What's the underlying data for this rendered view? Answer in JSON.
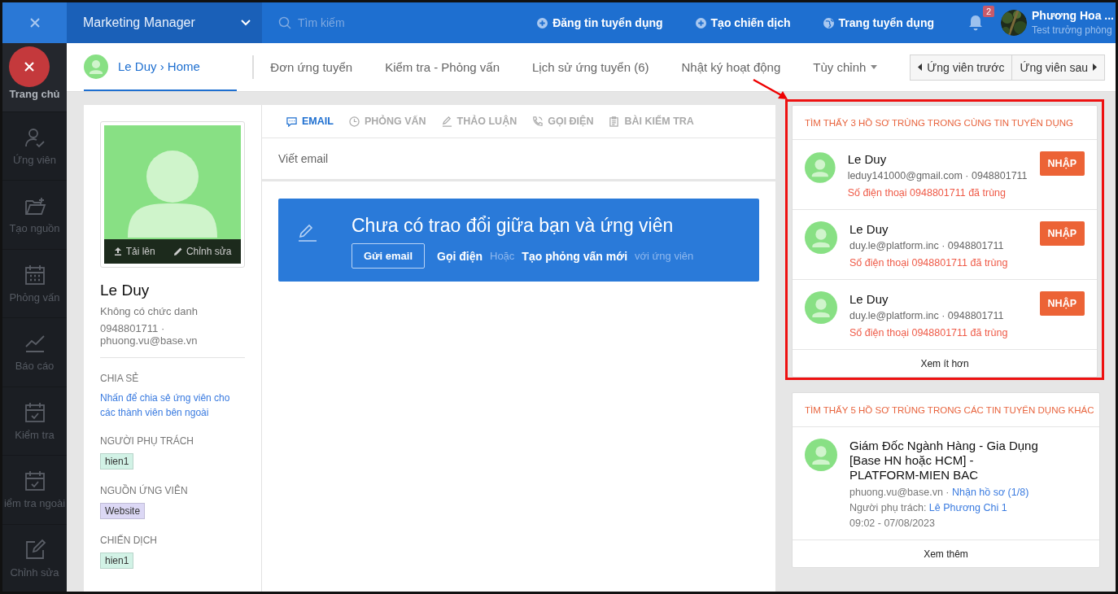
{
  "topbar": {
    "workspace": "Marketing Manager",
    "search": {
      "placeholder": "Tìm kiếm"
    },
    "actions": [
      {
        "label": "Đăng tin tuyển dụng"
      },
      {
        "label": "Tạo chiến dịch"
      },
      {
        "label": "Trang tuyển dụng"
      }
    ],
    "notifications": {
      "count": "2"
    },
    "user": {
      "name": "Phương Hoa ...",
      "role": "Test trưởng phòng"
    }
  },
  "sidebar": {
    "items": [
      {
        "label": "Trang chủ",
        "selected": true
      },
      {
        "label": "Ứng viên",
        "selected": false
      },
      {
        "label": "Tạo nguồn",
        "selected": false
      },
      {
        "label": "Phỏng vấn",
        "selected": false
      },
      {
        "label": "Báo cáo",
        "selected": false
      },
      {
        "label": "Kiểm tra",
        "selected": false
      },
      {
        "label": "iểm tra ngoài",
        "selected": false
      },
      {
        "label": "Chỉnh sửa",
        "selected": false
      }
    ]
  },
  "breadcrumb": {
    "name": "Le Duy",
    "separator": "›",
    "page": "Home",
    "selected": true
  },
  "tabs": [
    {
      "label": "Đơn ứng tuyển",
      "selected": false,
      "dropdown": false
    },
    {
      "label": "Kiểm tra - Phỏng vấn",
      "selected": false,
      "dropdown": false
    },
    {
      "label": "Lịch sử ứng tuyển (6)",
      "selected": false,
      "dropdown": false
    },
    {
      "label": "Nhật ký hoạt động",
      "selected": false,
      "dropdown": false
    },
    {
      "label": "Tùy chỉnh",
      "selected": false,
      "dropdown": true
    }
  ],
  "nav_buttons": [
    {
      "label": "Ứng viên trước"
    },
    {
      "label": "Ứng viên sau"
    }
  ],
  "profile": {
    "photo_actions": [
      {
        "label": "Tải lên"
      },
      {
        "label": "Chỉnh sửa"
      }
    ],
    "name": "Le Duy",
    "title": "Không có chức danh",
    "contact": "0948801711 · phuong.vu@base.vn",
    "sections": [
      {
        "heading": "CHIA SẺ",
        "kind": "link",
        "text": "Nhấn để chia sẻ ứng viên cho các thành viên bên ngoài"
      },
      {
        "heading": "NGƯỜI PHỤ TRÁCH",
        "kind": "tag",
        "text": "hien1",
        "color": "#d2f2e6"
      },
      {
        "heading": "NGUỒN ỨNG VIÊN",
        "kind": "tag",
        "text": "Website",
        "color": "#dcd8f5"
      },
      {
        "heading": "CHIẾN DỊCH",
        "kind": "tag",
        "text": "hien1",
        "color": "#d2f2e6"
      }
    ]
  },
  "activity": {
    "tabs": [
      {
        "label": "EMAIL",
        "selected": true
      },
      {
        "label": "PHỎNG VẤN",
        "selected": false
      },
      {
        "label": "THẢO LUẬN",
        "selected": false
      },
      {
        "label": "GỌI ĐIỆN",
        "selected": false
      },
      {
        "label": "BÀI KIỂM TRA",
        "selected": false
      }
    ],
    "compose": "Viết email",
    "empty": {
      "message": "Chưa có trao đổi giữa bạn và ứng viên",
      "button": "Gửi email",
      "call": "Gọi điện",
      "or": "Hoặc",
      "interview": "Tạo phỏng vấn mới",
      "suffix": "với ứng viên"
    }
  },
  "duplicates_same": {
    "title": "TÌM THẤY 3 HỒ SƠ TRÙNG TRONG CÙNG TIN TUYỂN DỤNG",
    "highlighted": true,
    "items": [
      {
        "name": "Le Duy",
        "contact": "leduy141000@gmail.com · 0948801711",
        "warning": "Số điện thoại 0948801711 đã trùng",
        "action": "NHẬP"
      },
      {
        "name": "Le Duy",
        "contact": "duy.le@platform.inc · 0948801711",
        "warning": "Số điện thoại 0948801711 đã trùng",
        "action": "NHẬP"
      },
      {
        "name": "Le Duy",
        "contact": "duy.le@platform.inc · 0948801711",
        "warning": "Số điện thoại 0948801711 đã trùng",
        "action": "NHẬP"
      }
    ],
    "footer": "Xem ít hơn"
  },
  "duplicates_other": {
    "title": "TÌM THẤY 5 HỒ SƠ TRÙNG TRONG CÁC TIN TUYỂN DỤNG KHÁC",
    "items": [
      {
        "job": "Giám Đốc Ngành Hàng - Gia Dụng [Base HN hoặc HCM] - PLATFORM-MIEN BAC",
        "email": "phuong.vu@base.vn",
        "separator": "·",
        "status": "Nhận hồ sơ (1/8)",
        "owner_label": "Người phụ trách:",
        "owner": "Lê Phương Chi 1",
        "time": "09:02 - 07/08/2023"
      }
    ],
    "footer": "Xem thêm"
  }
}
